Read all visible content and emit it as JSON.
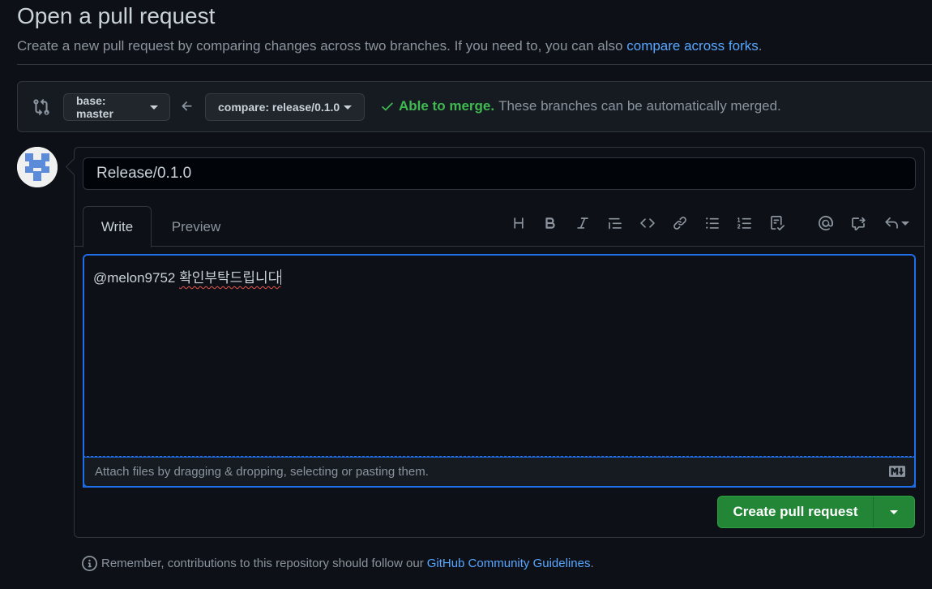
{
  "header": {
    "title": "Open a pull request",
    "subtitle": "Create a new pull request by comparing changes across two branches. If you need to, you can also",
    "subtitle_link": "compare across forks",
    "subtitle_end": "."
  },
  "range": {
    "base_label": "base: master",
    "compare_label": "compare: release/0.1.0",
    "merge_ok": "Able to merge.",
    "merge_text": "These branches can be automatically merged."
  },
  "form": {
    "title_value": "Release/0.1.0",
    "tabs": [
      {
        "label": "Write",
        "selected": true
      },
      {
        "label": "Preview",
        "selected": false
      }
    ],
    "body_mention": "@melon9752",
    "body_text": "확인부탁드립니다",
    "attach_text": "Attach files by dragging & dropping, selecting or pasting them.",
    "create_label": "Create pull request"
  },
  "footer": {
    "note": "Remember, contributions to this repository should follow our",
    "link": "GitHub Community Guidelines",
    "end": "."
  },
  "toolbar": [
    "heading-icon",
    "bold-icon",
    "italic-icon",
    "quote-icon",
    "code-icon",
    "link-icon",
    "bulleted-list-icon",
    "numbered-list-icon",
    "task-list-icon",
    "mention-icon",
    "cross-reference-icon",
    "reply-icon"
  ],
  "colors": {
    "background": "#0d1117",
    "accent_blue": "#58a6ff",
    "success_green": "#3fb950",
    "button_green": "#238636",
    "focus_border": "#1f6feb"
  }
}
